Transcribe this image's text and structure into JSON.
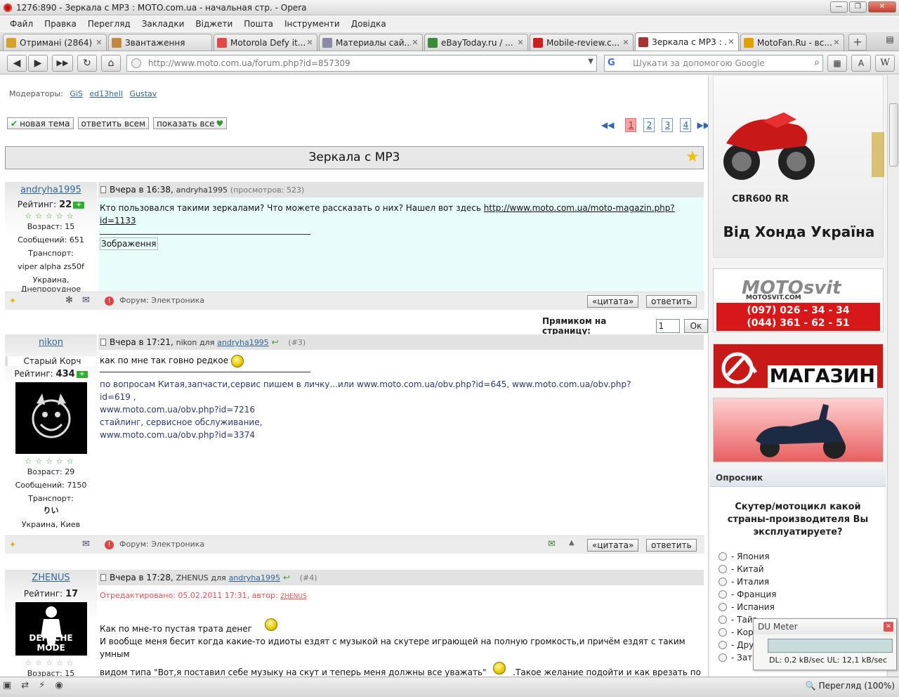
{
  "window": {
    "title": "1276:890 - Зеркала с MP3 : MOTO.com.ua - начальная стр. - Opera",
    "min": "—",
    "max": "❐",
    "close": "✕"
  },
  "menu": [
    "Файл",
    "Правка",
    "Перегляд",
    "Закладки",
    "Віджети",
    "Пошта",
    "Інструменти",
    "Довідка"
  ],
  "tabs": [
    {
      "label": "Отримані (2864)",
      "color": "#d9a030"
    },
    {
      "label": "Звантаження",
      "color": "#c08a40"
    },
    {
      "label": "Motorola Defy it...",
      "color": "#e0484a"
    },
    {
      "label": "Материалы сай...",
      "color": "#8a8aa8"
    },
    {
      "label": "eBayToday.ru / ...",
      "color": "#3a8a3a"
    },
    {
      "label": "Mobile-review.c...",
      "color": "#cc2020"
    },
    {
      "label": "Зеркала с MP3 : ...",
      "color": "#aa3030",
      "active": true
    },
    {
      "label": "MotoFan.Ru - вс...",
      "color": "#e0a000"
    }
  ],
  "nav": {
    "back": "◀",
    "forward": "▶",
    "fastfwd": "▶▶",
    "reload": "↻",
    "home": "⌂",
    "url": "http://www.moto.com.ua/forum.php?id=857309",
    "search_placeholder": "Шукати за допомогою Google"
  },
  "forum": {
    "moderators_label": "Модераторы:",
    "moderators": [
      "GiS",
      "ed13hell",
      "Gustav"
    ],
    "new_topic": "новая тема",
    "reply_all": "ответить всем",
    "show_all": "показать все",
    "pages": [
      "1",
      "2",
      "3",
      "4"
    ],
    "prev_arrow": "◀◀",
    "next_arrow": "▶▶",
    "thread_title": "Зеркала с MP3",
    "go_page_label": "Прямиком на страницу:",
    "go_page_value": "1",
    "go_ok": "Ок",
    "quote": "«цитата»",
    "reply": "ответить",
    "forum_label": "Форум: Электроника"
  },
  "posts": [
    {
      "user": "andryha1995",
      "rating_label": "Рейтинг:",
      "rating": "22",
      "stars": "☆☆☆☆☆",
      "age": "Возраст: 15",
      "messages": "Сообщений: 651",
      "transport_label": "Транспорт:",
      "transport": "viper alpha zs50f",
      "location": "Украина, Днепрорудное",
      "time": "Вчера в 16:38,",
      "author": "andryha1995",
      "views": "(просмотров: 523)",
      "text": "Кто пользовался такими зеркалами? Что можете рассказать о них? Нашел вот здесь",
      "link": "http://www.moto.com.ua/moto-magazin.php?id=1133",
      "image_alt": "Зображення"
    },
    {
      "user": "nikon",
      "title": "Старый Корч",
      "rating_label": "Рейтинг:",
      "rating": "434",
      "stars": "☆☆☆☆☆",
      "age": "Возраст: 29",
      "messages": "Сообщений: 7150",
      "transport_label": "Транспорт:",
      "transport": "りい",
      "location": "Украина, Киев",
      "time": "Вчера в 17:21,",
      "author": "nikon",
      "to": "для",
      "reply_to": "andryha1995",
      "num": "(#3)",
      "text": "как по мне так говно редкое",
      "sig1": "по вопросам Китая,запчасти,сервис пишем в личку...или www.moto.com.ua/obv.php?id=645, www.moto.com.ua/obv.php?id=619 ,",
      "sig2": "www.moto.com.ua/obv.php?id=7216",
      "sig3": "стайлинг, сервисное обслуживание, www.moto.com.ua/obv.php?id=3374"
    },
    {
      "user": "ZHENUS",
      "rating_label": "Рейтинг:",
      "rating": "17",
      "avatar_text": "DEPECHE MODE",
      "stars": "☆☆☆☆☆",
      "age": "Возраст: 15",
      "time": "Вчера в 17:28,",
      "author": "ZHENUS",
      "to": "для",
      "reply_to": "andryha1995",
      "num": "(#4)",
      "edited": "Отредактировано: 05.02.2011 17:31, автор:",
      "edited_by": "ZHENUS",
      "line1": "Как по мне-то пустая трата денег",
      "line2": "И вообще меня бесит когда какие-то идиоты ездят с музыкой на скутере играющей на полную громкость,и причём ездят с таким умным",
      "line3a": "видом типа \"Вот,я поставил себе музыку на скут и теперь меня должны все уважать\"",
      "line3b": ".Такое желание подойти и как врезать по"
    }
  ],
  "sidebar": {
    "ad1_model": "CBR600 RR",
    "ad1_brand": "Від Хонда Україна",
    "ad2_logo": "MOTOsvit",
    "ad2_site": "MOTOSVIT.COM",
    "ad2_phone1": "(097) 026 - 34 - 34",
    "ad2_phone2": "(044) 361 - 62 - 51",
    "ad3_text": "МАГАЗИН",
    "poll_title": "Опросник",
    "poll_question": "Скутер/мотоцикл какой страны-производителя Вы эксплуатируете?",
    "poll_options": [
      "- Япония",
      "- Китай",
      "- Италия",
      "- Франция",
      "- Испания",
      "- Тайв",
      "- Коре",
      "- Друг",
      "- Затр"
    ]
  },
  "du_meter": {
    "title": "DU Meter",
    "readout": "DL: 0,2 kB/sec  UL: 12,1 kB/sec"
  },
  "status": {
    "zoom": "Перегляд (100%)"
  }
}
